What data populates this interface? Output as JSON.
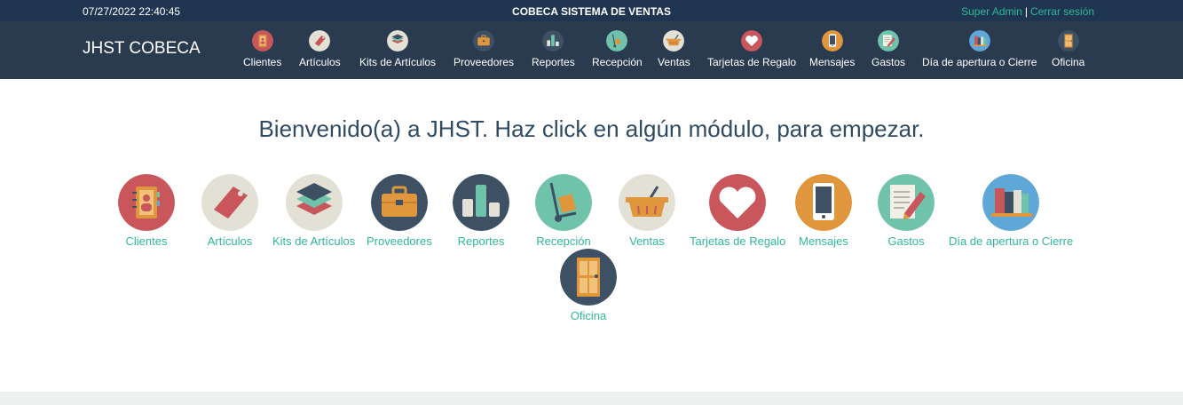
{
  "topbar": {
    "datetime": "07/27/2022 22:40:45",
    "system_title": "COBECA SISTEMA DE VENTAS",
    "user_name": "Super Admin",
    "separator": "|",
    "logout": "Cerrar sesión"
  },
  "brand": "JHST COBECA",
  "nav": [
    {
      "label": "Clientes",
      "icon": "contacts-book-icon"
    },
    {
      "label": "Artículos",
      "icon": "price-tag-icon"
    },
    {
      "label": "Kits de Artículos",
      "icon": "layers-icon"
    },
    {
      "label": "Proveedores",
      "icon": "briefcase-icon"
    },
    {
      "label": "Reportes",
      "icon": "bar-chart-icon"
    },
    {
      "label": "Recepción",
      "icon": "hand-truck-icon"
    },
    {
      "label": "Ventas",
      "icon": "shopping-basket-icon"
    },
    {
      "label": "Tarjetas de Regalo",
      "icon": "heart-icon"
    },
    {
      "label": "Mensajes",
      "icon": "mobile-phone-icon"
    },
    {
      "label": "Gastos",
      "icon": "notepad-pencil-icon"
    },
    {
      "label": "Día de apertura o Cierre",
      "icon": "books-icon"
    },
    {
      "label": "Oficina",
      "icon": "door-icon"
    }
  ],
  "welcome_message": "Bienvenido(a) a JHST. Haz click en algún módulo, para empezar.",
  "modules": [
    {
      "label": "Clientes",
      "icon": "contacts-book-icon"
    },
    {
      "label": "Artículos",
      "icon": "price-tag-icon"
    },
    {
      "label": "Kits de Artículos",
      "icon": "layers-icon"
    },
    {
      "label": "Proveedores",
      "icon": "briefcase-icon"
    },
    {
      "label": "Reportes",
      "icon": "bar-chart-icon"
    },
    {
      "label": "Recepción",
      "icon": "hand-truck-icon"
    },
    {
      "label": "Ventas",
      "icon": "shopping-basket-icon"
    },
    {
      "label": "Tarjetas de Regalo",
      "icon": "heart-icon"
    },
    {
      "label": "Mensajes",
      "icon": "mobile-phone-icon"
    },
    {
      "label": "Gastos",
      "icon": "notepad-pencil-icon"
    },
    {
      "label": "Día de apertura o Cierre",
      "icon": "books-icon"
    },
    {
      "label": "Oficina",
      "icon": "door-icon"
    }
  ],
  "colors": {
    "topbar_bg": "#1f3550",
    "navbar_bg": "#2a3b4f",
    "accent_link": "#2fb89a",
    "welcome_text": "#2f4a63"
  }
}
